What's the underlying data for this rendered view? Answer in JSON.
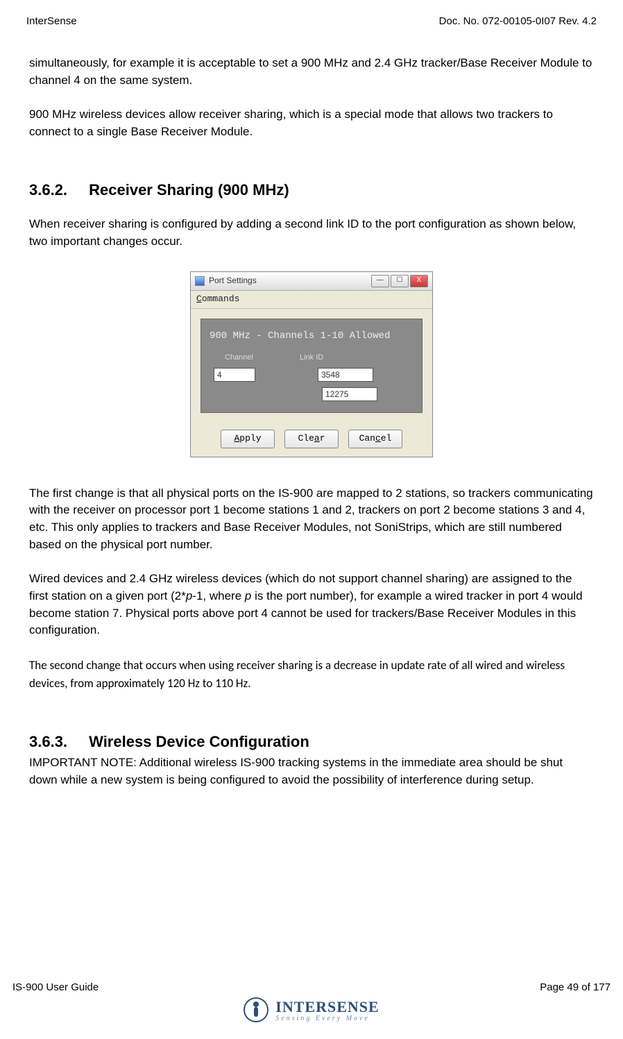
{
  "header": {
    "left": "InterSense",
    "right": "Doc. No. 072-00105-0I07 Rev. 4.2"
  },
  "body": {
    "p1": "simultaneously, for example it is acceptable to set a 900 MHz and 2.4 GHz tracker/Base Receiver Module to channel 4 on the same system.",
    "p2": "900 MHz wireless devices allow receiver sharing, which is a special mode that allows two trackers to connect to a single Base Receiver Module.",
    "sec_362_no": "3.6.2.",
    "sec_362_title": "Receiver Sharing (900 MHz)",
    "p3": "When receiver sharing is configured by adding a second link ID to the port configuration as shown below, two important changes occur.",
    "p4a": "The first change is that all physical ports on the IS-900 are mapped to 2 stations, so trackers communicating with the receiver on processor port 1 become stations 1 and 2, trackers on port 2 become stations 3 and 4, etc.  This only applies to trackers and Base Receiver Modules, not SoniStrips, which are still numbered based on the physical port number.",
    "p4b_pre": "Wired devices and 2.4 GHz wireless devices (which do not support channel sharing) are assigned to the first station on a given port (2*",
    "p4b_var": "p",
    "p4b_mid": "-1, where ",
    "p4b_var2": "p",
    "p4b_post": " is the port number), for example a wired tracker in port 4 would become station 7.  Physical ports above port 4 cannot be used for trackers/Base Receiver Modules in this configuration.",
    "p5": "The second change that occurs when using receiver sharing is a decrease in update rate of all wired and wireless devices, from approximately 120 Hz to 110 Hz.",
    "sec_363_no": "3.6.3.",
    "sec_363_title": "Wireless Device Configuration",
    "p6": "IMPORTANT NOTE: Additional wireless IS-900 tracking systems in the immediate area should be shut down while a new system is being configured to avoid the possibility of interference during setup."
  },
  "dialog": {
    "title": "Port Settings",
    "menu_u": "C",
    "menu_rest": "ommands",
    "caption": "900 MHz - Channels 1-10 Allowed",
    "label_channel": "Channel",
    "label_linkid": "Link ID",
    "channel_value": "4",
    "linkid1_value": "3548",
    "linkid2_value": "12275",
    "btn_apply_u": "A",
    "btn_apply_rest": "pply",
    "btn_clear_pre": "Cle",
    "btn_clear_u": "a",
    "btn_clear_post": "r",
    "btn_cancel_pre": "Can",
    "btn_cancel_u": "c",
    "btn_cancel_post": "el",
    "win_min": "—",
    "win_max": "☐",
    "win_close": "X"
  },
  "footer": {
    "left": "IS-900 User Guide",
    "right": "Page 49 of 177",
    "brand": "INTERSENSE",
    "tag": "Sensing Every Move"
  }
}
